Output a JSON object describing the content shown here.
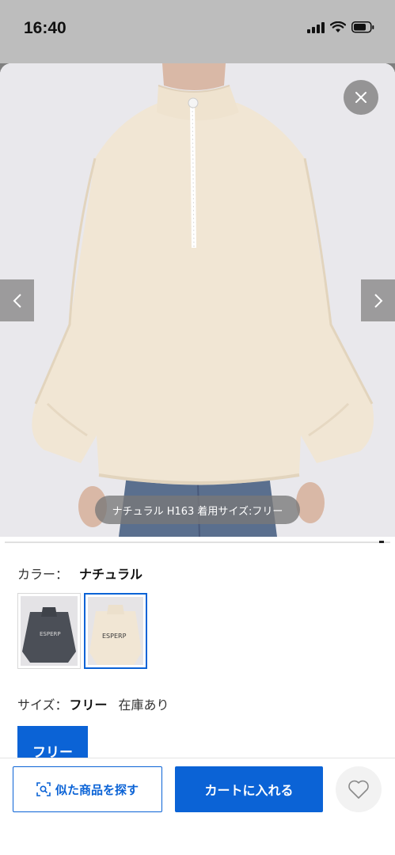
{
  "status_bar": {
    "time": "16:40",
    "signal_icon": "signal-icon",
    "wifi_icon": "wifi-icon",
    "battery_icon": "battery-icon"
  },
  "gallery": {
    "caption": "ナチュラル H163 着用サイズ:フリー",
    "close_icon": "close-icon",
    "prev_icon": "chevron-left-icon",
    "next_icon": "chevron-right-icon"
  },
  "color": {
    "label": "カラー：",
    "selected": "ナチュラル",
    "swatches": [
      {
        "name": "charcoal",
        "selected": false
      },
      {
        "name": "natural",
        "selected": true
      }
    ],
    "swatch_print": "ESPERP"
  },
  "size": {
    "label": "サイズ：",
    "selected": "フリー",
    "stock": "在庫あり",
    "options": [
      "フリー"
    ]
  },
  "actions": {
    "similar_label": "似た商品を探す",
    "similar_icon": "image-search-icon",
    "cart_label": "カートに入れる",
    "favorite_icon": "heart-icon"
  },
  "colors": {
    "accent": "#0b63d6",
    "fleece": "#f1e6d4",
    "charcoal": "#4b4f57"
  }
}
